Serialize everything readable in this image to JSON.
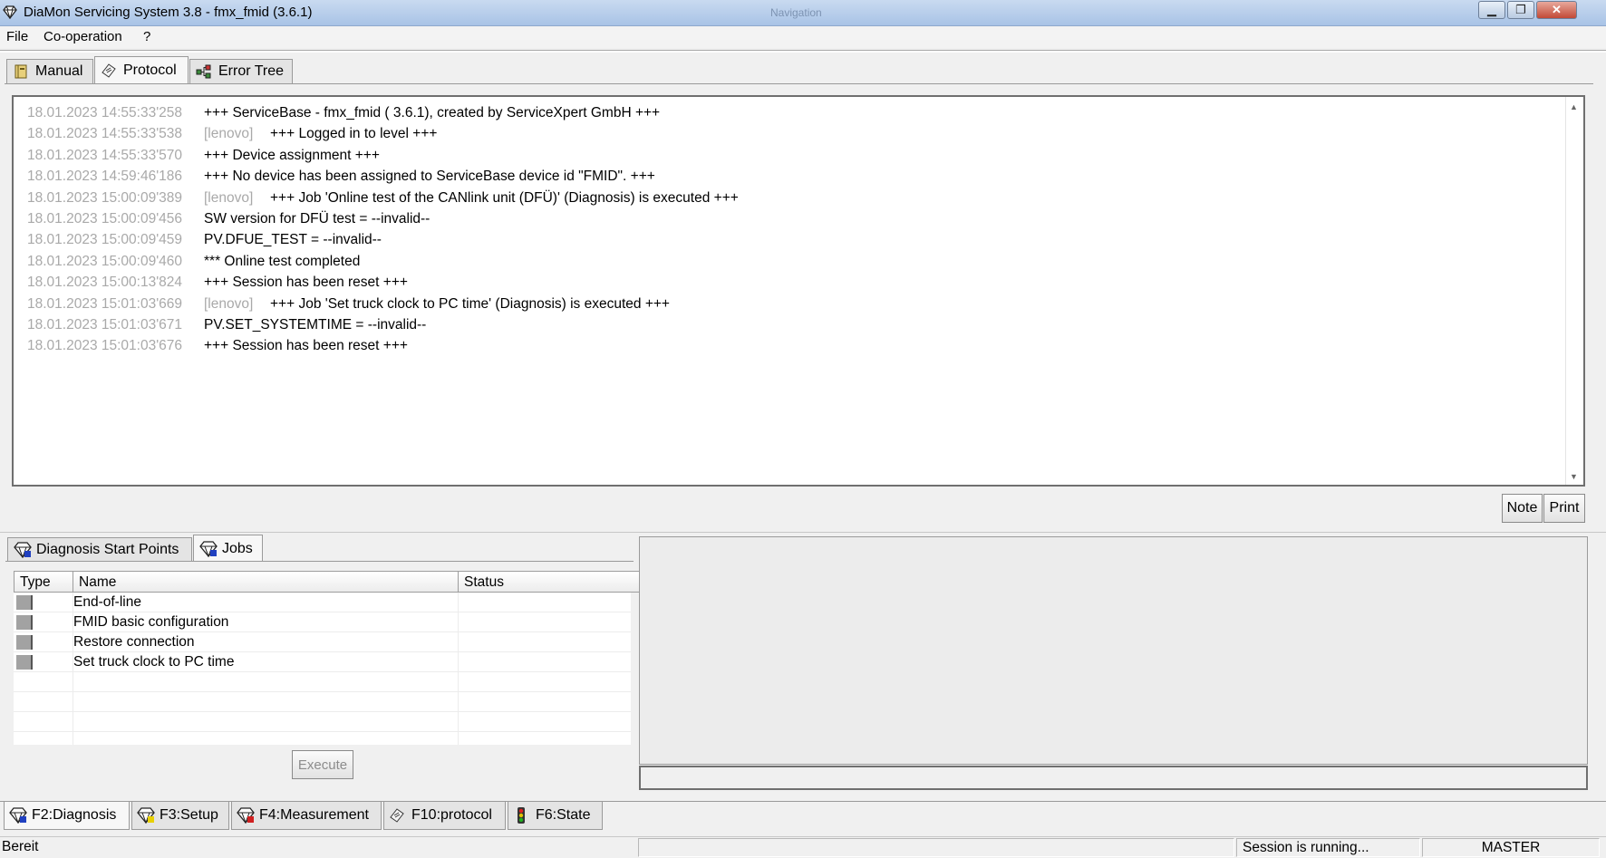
{
  "window": {
    "title": "DiaMon Servicing System 3.8 - fmx_fmid (3.6.1)",
    "center_caption": "Navigation",
    "minimize_glyph": "▁",
    "restore_glyph": "❐",
    "close_glyph": "✕"
  },
  "menu": [
    "File",
    "Co-operation",
    "?"
  ],
  "top_tabs": [
    {
      "label": "Manual",
      "icon": "manual-icon",
      "active": false
    },
    {
      "label": "Protocol",
      "icon": "protocol-icon",
      "active": true
    },
    {
      "label": "Error Tree",
      "icon": "error-tree-icon",
      "active": false
    }
  ],
  "log": [
    {
      "time": "18.01.2023 14:55:33'258",
      "user": "",
      "message": "+++ ServiceBase - fmx_fmid ( 3.6.1), created by ServiceXpert GmbH +++"
    },
    {
      "time": "18.01.2023 14:55:33'538",
      "user": "[lenovo]",
      "message": "+++ Logged in to level +++"
    },
    {
      "time": "18.01.2023 14:55:33'570",
      "user": "",
      "message": "+++ Device assignment +++"
    },
    {
      "time": "18.01.2023 14:59:46'186",
      "user": "",
      "message": "+++ No device has been assigned to ServiceBase device id \"FMID\". +++"
    },
    {
      "time": "18.01.2023 15:00:09'389",
      "user": "[lenovo]",
      "message": "+++ Job 'Online test of the CANlink unit (DFÜ)' (Diagnosis) is executed +++"
    },
    {
      "time": "18.01.2023 15:00:09'456",
      "user": "",
      "message": "SW version for DFÜ test = --invalid--"
    },
    {
      "time": "18.01.2023 15:00:09'459",
      "user": "",
      "message": "PV.DFUE_TEST = --invalid--"
    },
    {
      "time": "18.01.2023 15:00:09'460",
      "user": "",
      "message": "*** Online test completed"
    },
    {
      "time": "18.01.2023 15:00:13'824",
      "user": "",
      "message": "+++ Session has been reset +++"
    },
    {
      "time": "18.01.2023 15:01:03'669",
      "user": "[lenovo]",
      "message": "+++ Job 'Set truck clock to PC time' (Diagnosis) is executed +++"
    },
    {
      "time": "18.01.2023 15:01:03'671",
      "user": "",
      "message": "PV.SET_SYSTEMTIME = --invalid--"
    },
    {
      "time": "18.01.2023 15:01:03'676",
      "user": "",
      "message": "+++ Session has been reset +++"
    }
  ],
  "log_buttons": {
    "note": "Note",
    "print": "Print"
  },
  "lower_tabs": [
    {
      "label": "Diagnosis Start Points",
      "icon": "diagnosis-start-icon",
      "active": false
    },
    {
      "label": "Jobs",
      "icon": "jobs-icon",
      "active": true
    }
  ],
  "jobs_table": {
    "columns": [
      "Type",
      "Name",
      "Status"
    ],
    "rows": [
      {
        "name": "End-of-line",
        "status": ""
      },
      {
        "name": "FMID basic configuration",
        "status": ""
      },
      {
        "name": "Restore connection",
        "status": ""
      },
      {
        "name": "Set truck clock to PC time",
        "status": ""
      }
    ]
  },
  "execute_label": "Execute",
  "bottom_tabs": [
    {
      "label": "F2:Diagnosis",
      "icon": "diagnosis-icon",
      "active": true
    },
    {
      "label": "F3:Setup",
      "icon": "setup-icon",
      "active": false
    },
    {
      "label": "F4:Measurement",
      "icon": "measurement-icon",
      "active": false
    },
    {
      "label": "F10:protocol",
      "icon": "protocol-icon",
      "active": false
    },
    {
      "label": "F6:State",
      "icon": "state-icon",
      "active": false
    }
  ],
  "statusbar": {
    "ready": "Bereit",
    "session": "Session is running...",
    "level": "MASTER"
  }
}
